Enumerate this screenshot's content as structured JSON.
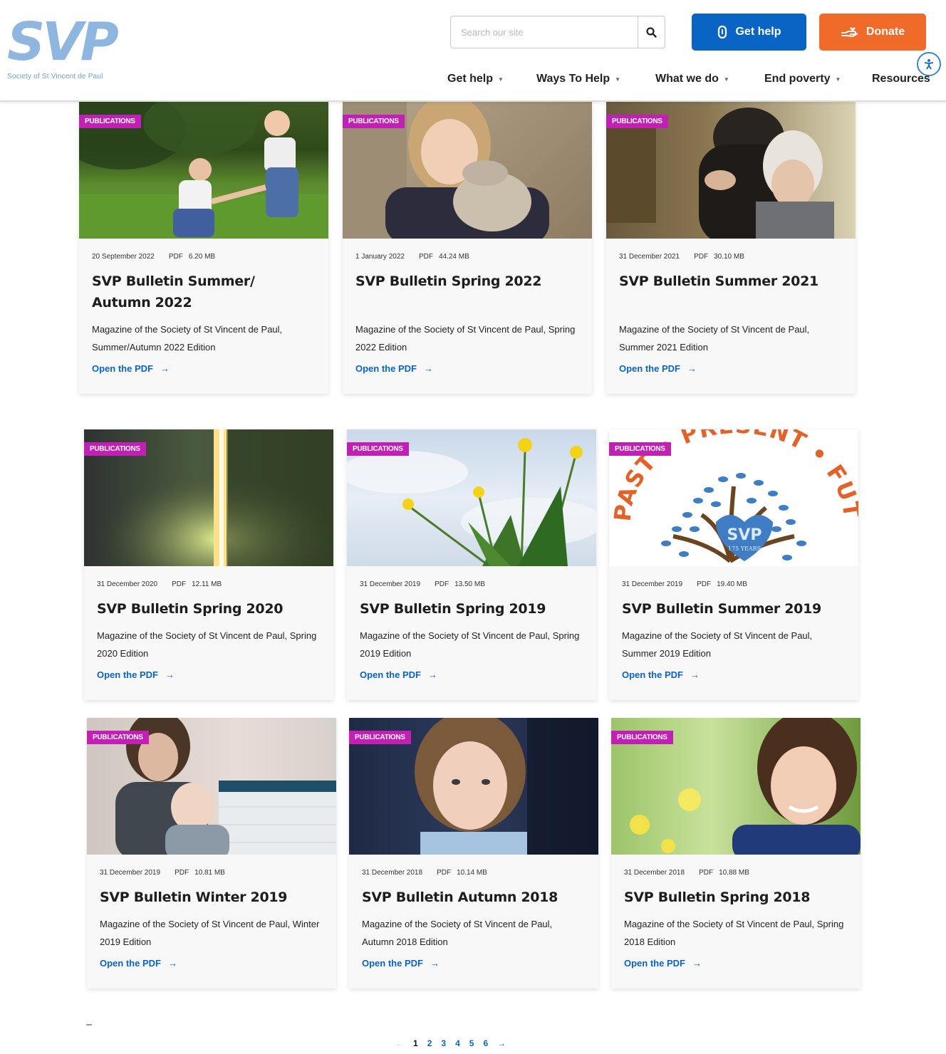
{
  "header": {
    "logo_text": "SVP",
    "logo_subtitle": "Society of St Vincent de Paul",
    "search_placeholder": "Search our site",
    "get_help_label": "Get help",
    "donate_label": "Donate"
  },
  "nav": {
    "items": [
      {
        "label": "Get help"
      },
      {
        "label": "Ways To Help"
      },
      {
        "label": "What we do"
      },
      {
        "label": "End poverty"
      },
      {
        "label": "Resources"
      }
    ]
  },
  "cards": [
    {
      "badge": "PUBLICATIONS",
      "date": "20 September 2022",
      "type": "PDF",
      "size": "6.20 MB",
      "title": "SVP Bulletin Summer/ Autumn 2022",
      "desc": "Magazine of the Society of St Vincent de Paul, Summer/Autumn 2022 Edition",
      "link": "Open the PDF"
    },
    {
      "badge": "PUBLICATIONS",
      "date": "1 January 2022",
      "type": "PDF",
      "size": "44.24 MB",
      "title": "SVP Bulletin Spring 2022",
      "desc": "Magazine of the Society of St Vincent de Paul, Spring 2022 Edition",
      "link": "Open the PDF"
    },
    {
      "badge": "PUBLICATIONS",
      "date": "31 December 2021",
      "type": "PDF",
      "size": "30.10 MB",
      "title": "SVP Bulletin Summer 2021",
      "desc": "Magazine of the Society of St Vincent de Paul, Summer 2021 Edition",
      "link": "Open the PDF"
    },
    {
      "badge": "PUBLICATIONS",
      "date": "31 December 2020",
      "type": "PDF",
      "size": "12.11 MB",
      "title": "SVP Bulletin Spring 2020",
      "desc": "Magazine of the Society of St Vincent de Paul, Spring 2020 Edition",
      "link": "Open the PDF"
    },
    {
      "badge": "PUBLICATIONS",
      "date": "31 December 2019",
      "type": "PDF",
      "size": "13.50 MB",
      "title": "SVP Bulletin Spring 2019",
      "desc": "Magazine of the Society of St Vincent de Paul, Spring 2019 Edition",
      "link": "Open the PDF"
    },
    {
      "badge": "PUBLICATIONS",
      "date": "31 December 2019",
      "type": "PDF",
      "size": "19.40 MB",
      "title": "SVP Bulletin Summer 2019",
      "desc": "Magazine of the Society of St Vincent de Paul, Summer 2019 Edition",
      "link": "Open the PDF",
      "logo_lettering": "PAST • PRESENT • FUTURE",
      "logo_mark": "SVP",
      "logo_years": "175 YEARS"
    },
    {
      "badge": "PUBLICATIONS",
      "date": "31 December 2019",
      "type": "PDF",
      "size": "10.81 MB",
      "title": "SVP Bulletin Winter 2019",
      "desc": "Magazine of the Society of St Vincent de Paul, Winter 2019 Edition",
      "link": "Open the PDF"
    },
    {
      "badge": "PUBLICATIONS",
      "date": "31 December 2018",
      "type": "PDF",
      "size": "10.14 MB",
      "title": "SVP Bulletin Autumn 2018",
      "desc": "Magazine of the Society of St Vincent de Paul, Autumn 2018 Edition",
      "link": "Open the PDF"
    },
    {
      "badge": "PUBLICATIONS",
      "date": "31 December 2018",
      "type": "PDF",
      "size": "10.88 MB",
      "title": "SVP Bulletin Spring 2018",
      "desc": "Magazine of the Society of St Vincent de Paul, Spring 2018 Edition",
      "link": "Open the PDF"
    }
  ],
  "pagination": {
    "pages": [
      "1",
      "2",
      "3",
      "4",
      "5",
      "6"
    ],
    "current": "1"
  },
  "colors": {
    "primary_blue": "#0a64c4",
    "donate_orange": "#f06a2a",
    "badge_magenta": "#c21fb4",
    "logo_blue": "#8fb6de"
  }
}
